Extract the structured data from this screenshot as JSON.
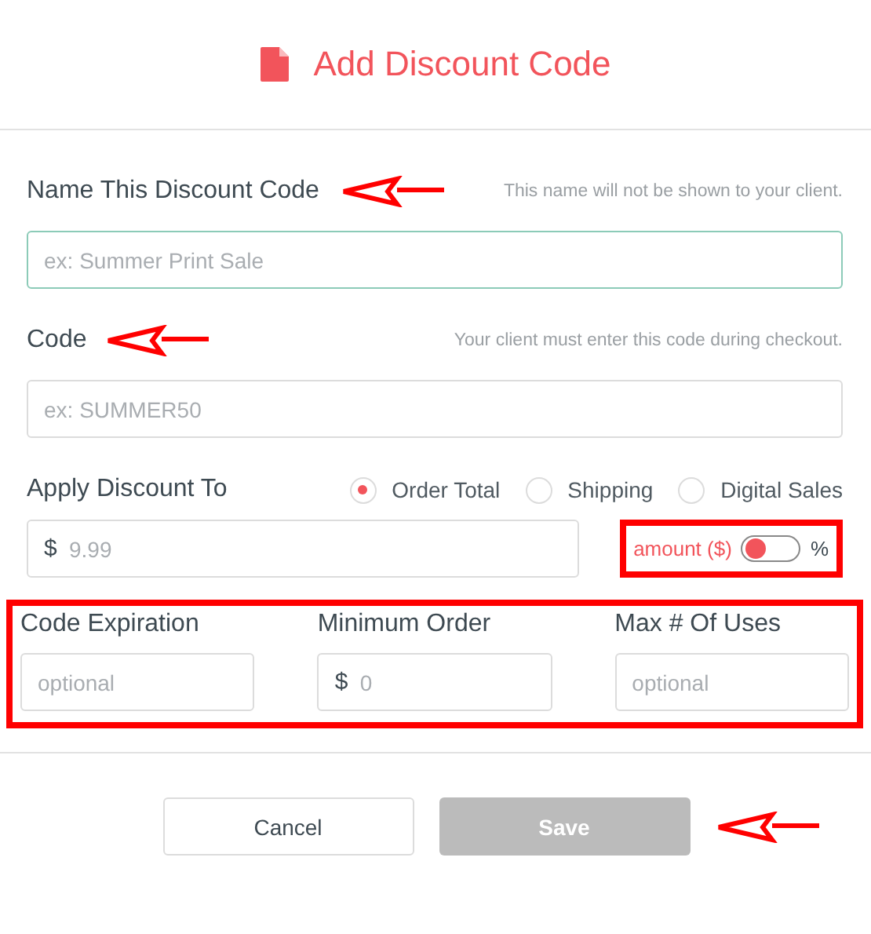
{
  "title": "Add Discount Code",
  "name_field": {
    "label": "Name This Discount Code",
    "hint": "This name will not be shown to your client.",
    "placeholder": "ex: Summer Print Sale",
    "focused": true
  },
  "code_field": {
    "label": "Code",
    "hint": "Your client must enter this code during checkout.",
    "placeholder": "ex: SUMMER50",
    "focused": false
  },
  "apply_to": {
    "label": "Apply Discount To",
    "options": [
      {
        "label": "Order Total",
        "selected": true
      },
      {
        "label": "Shipping",
        "selected": false
      },
      {
        "label": "Digital Sales",
        "selected": false
      }
    ]
  },
  "amount": {
    "prefix": "$",
    "placeholder": "9.99"
  },
  "unit_toggle": {
    "left_label": "amount ($)",
    "right_label": "%",
    "on": false
  },
  "extra_fields": [
    {
      "label": "Code Expiration",
      "placeholder": "optional"
    },
    {
      "label": "Minimum Order",
      "prefix": "$",
      "placeholder": "0"
    },
    {
      "label": "Max # Of Uses",
      "placeholder": "optional"
    }
  ],
  "buttons": [
    {
      "label": "Cancel",
      "kind": "secondary",
      "disabled": false
    },
    {
      "label": "Save",
      "kind": "primary",
      "disabled": true
    }
  ]
}
